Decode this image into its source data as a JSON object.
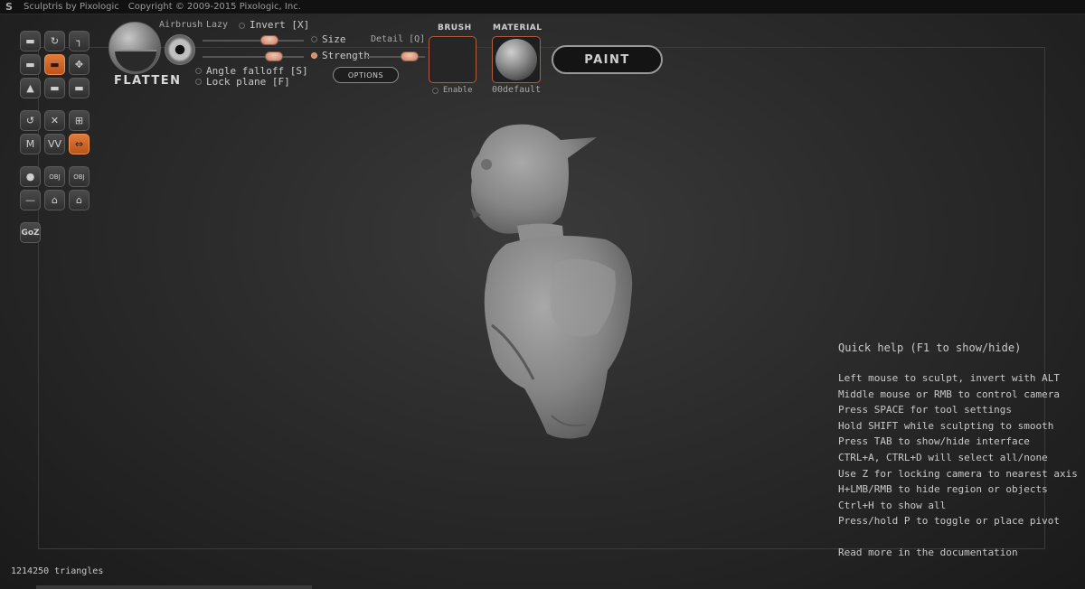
{
  "window": {
    "title": "Sculptris by Pixologic",
    "copyright": "Copyright © 2009-2015 Pixologic, Inc."
  },
  "toolbar": {
    "tools": [
      {
        "id": "draw",
        "label": "▬",
        "active": false
      },
      {
        "id": "rotate",
        "label": "↻",
        "active": false
      },
      {
        "id": "crop",
        "label": "┐",
        "active": false
      },
      {
        "id": "inflate",
        "label": "▬",
        "active": false
      },
      {
        "id": "flatten",
        "label": "▬",
        "active": true
      },
      {
        "id": "move",
        "label": "✥",
        "active": false
      },
      {
        "id": "pinch",
        "label": "▲",
        "active": false
      },
      {
        "id": "crease",
        "label": "▬",
        "active": false
      },
      {
        "id": "smooth",
        "label": "▬",
        "active": false
      },
      {
        "id": "symmetry",
        "label": "↺",
        "active": false
      },
      {
        "id": "mask",
        "label": "✕",
        "active": false
      },
      {
        "id": "wireframe",
        "label": "⊞",
        "active": false
      },
      {
        "id": "matcap",
        "label": "M",
        "active": false
      },
      {
        "id": "grab",
        "label": "VV",
        "active": false
      },
      {
        "id": "mirror",
        "label": "⇔",
        "active": true
      },
      {
        "id": "sphere",
        "label": "●",
        "active": false
      },
      {
        "id": "import-obj",
        "label": "OBJ",
        "active": false
      },
      {
        "id": "export-obj",
        "label": "OBJ",
        "active": false
      },
      {
        "id": "plane",
        "label": "—",
        "active": false
      },
      {
        "id": "open",
        "label": "⌂",
        "active": false
      },
      {
        "id": "save",
        "label": "⌂",
        "active": false
      }
    ],
    "goz_label": "GoZ"
  },
  "brush": {
    "name": "FLATTEN",
    "airbrush_label": "Airbrush",
    "lazy_label": "Lazy",
    "invert_label": "Invert [X]",
    "size_label": "Size",
    "strength_label": "Strength",
    "detail_label": "Detail [Q]",
    "angle_falloff_label": "Angle falloff [S]",
    "lock_plane_label": "Lock plane [F]",
    "options_label": "OPTIONS",
    "brush_header": "BRUSH",
    "enable_label": "Enable",
    "material_header": "MATERIAL",
    "material_name": "00default",
    "paint_label": "PAINT",
    "size_value": 0.7,
    "strength_value": 0.75,
    "detail_value": 0.85
  },
  "quick_help": {
    "title": "Quick help (F1 to show/hide)",
    "lines": [
      "Left mouse to sculpt, invert with ALT",
      "Middle mouse or RMB to control camera",
      "Press SPACE for tool settings",
      "Hold SHIFT while sculpting to smooth",
      "Press TAB to show/hide interface",
      "CTRL+A, CTRL+D will select all/none",
      "Use Z for locking camera to nearest axis",
      "H+LMB/RMB to hide region or objects",
      "Ctrl+H to show all",
      "Press/hold P to toggle or place pivot"
    ],
    "more": "Read more in the documentation"
  },
  "status": {
    "triangles": "1214250 triangles"
  },
  "colors": {
    "accent": "#d9682a",
    "background": "#2b2b2b"
  }
}
